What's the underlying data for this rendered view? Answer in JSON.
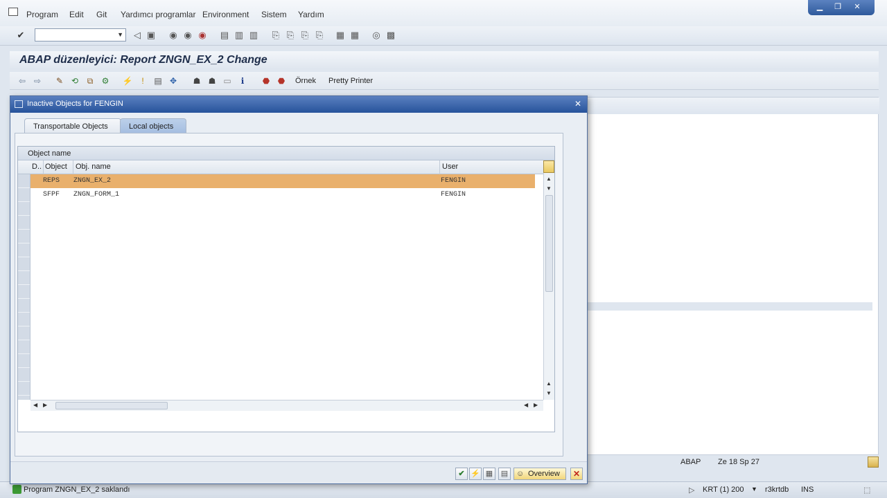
{
  "menu": {
    "items": [
      "Program",
      "Edit",
      "Git",
      "Yardımcı programlar",
      "Environment",
      "Sistem",
      "Yardım"
    ]
  },
  "title": "ABAP düzenleyici: Report ZNGN_EX_2 Change",
  "app_toolbar": {
    "example_label": "Örnek",
    "pretty_printer_label": "Pretty Printer"
  },
  "dialog": {
    "title": "Inactive Objects for FENGIN",
    "tabs": [
      "Transportable Objects",
      "Local objects"
    ],
    "active_tab": "Local objects",
    "grid": {
      "caption": "Object name",
      "columns": [
        "D..",
        "Object",
        "Obj. name",
        "User"
      ],
      "rows": [
        {
          "object": "REPS",
          "obj_name": "ZNGN_EX_2",
          "user": "FENGIN",
          "selected": true
        },
        {
          "object": "SFPF",
          "obj_name": "ZNGN_FORM_1",
          "user": "FENGIN",
          "selected": false
        }
      ]
    },
    "footer": {
      "overview_label": "Overview"
    }
  },
  "status_info": {
    "program": "ABAP",
    "position": "Ze  18 Sp  27"
  },
  "status_bar": {
    "message": "Program ZNGN_EX_2 saklandı",
    "system": "KRT (1) 200",
    "server": "r3krtdb",
    "mode": "INS"
  },
  "colors": {
    "selected_row": "#e9b06c",
    "dialog_title": "#27539b",
    "success": "#3d9b35"
  }
}
